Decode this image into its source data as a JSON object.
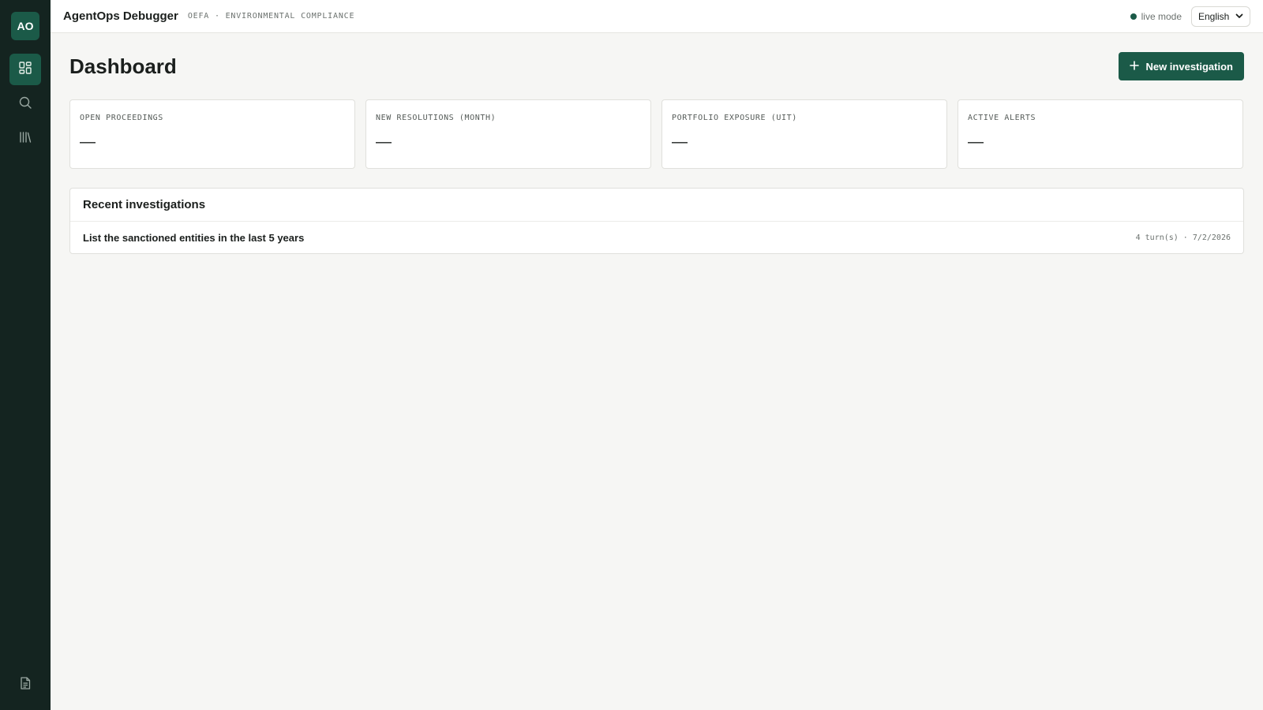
{
  "sidebar": {
    "logo_text": "AO",
    "items": [
      {
        "icon": "dashboard-icon",
        "active": true
      },
      {
        "icon": "search-icon",
        "active": false
      },
      {
        "icon": "library-icon",
        "active": false
      }
    ],
    "bottom_item": {
      "icon": "document-icon"
    }
  },
  "topbar": {
    "app_title": "AgentOps Debugger",
    "subtitle": "OEFA · ENVIRONMENTAL COMPLIANCE",
    "status_label": "live mode",
    "status_color": "#1b5a48",
    "language": "English"
  },
  "main": {
    "page_title": "Dashboard",
    "new_button_label": "New investigation",
    "stats": [
      {
        "label": "OPEN PROCEEDINGS",
        "value": "—"
      },
      {
        "label": "NEW RESOLUTIONS (MONTH)",
        "value": "—"
      },
      {
        "label": "PORTFOLIO EXPOSURE (UIT)",
        "value": "—"
      },
      {
        "label": "ACTIVE ALERTS",
        "value": "—"
      }
    ],
    "recent": {
      "title": "Recent investigations",
      "items": [
        {
          "title": "List the sanctioned entities in the last 5 years",
          "turns": "4 turn(s)",
          "separator": "·",
          "date": "7/2/2026"
        }
      ]
    }
  },
  "colors": {
    "sidebar_bg": "#142420",
    "accent": "#1b5a48",
    "page_bg": "#f6f6f4"
  }
}
